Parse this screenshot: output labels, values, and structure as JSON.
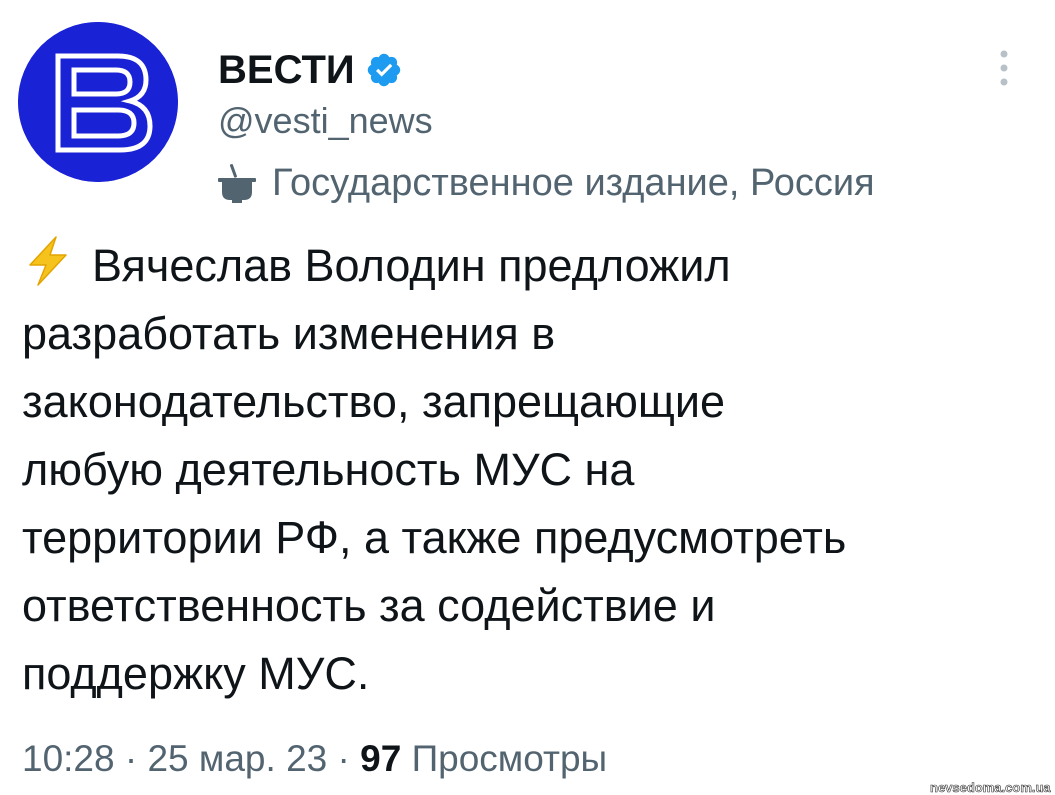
{
  "author": {
    "display_name": "ВЕСТИ",
    "handle": "@vesti_news",
    "verified": true,
    "avatar_letter": "В",
    "avatar_color": "#1a22d6",
    "label": "Государственное издание, Россия"
  },
  "tweet": {
    "icon": "lightning-bolt-icon",
    "lines": [
      "Вячеслав Володин предложил",
      "разработать изменения в",
      "законодательство, запрещающие",
      "любую деятельность МУС на",
      "территории РФ, а также предусмотреть",
      "ответственность за содействие и",
      "поддержку МУС."
    ]
  },
  "meta": {
    "time": "10:28",
    "separator": "·",
    "date": "25 мар. 23",
    "views_count": "97",
    "views_label": "Просмотры"
  },
  "watermark": "nevsedoma.com.ua",
  "colors": {
    "verified_badge": "#1d9bf0",
    "secondary_text": "#536471",
    "primary_text": "#0f1419",
    "bolt": "#f5c31c"
  }
}
